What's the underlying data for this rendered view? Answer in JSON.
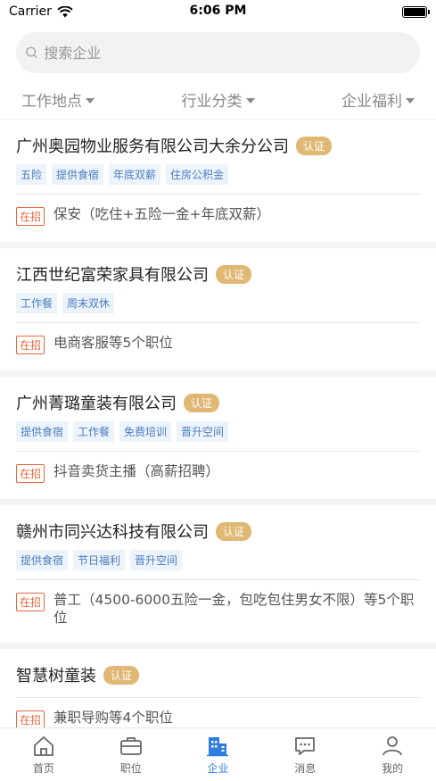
{
  "status": {
    "carrier": "Carrier",
    "time": "6:06 PM"
  },
  "search": {
    "placeholder": "搜索企业"
  },
  "filters": [
    {
      "label": "工作地点"
    },
    {
      "label": "行业分类"
    },
    {
      "label": "企业福利"
    }
  ],
  "companies": [
    {
      "name": "广州奥园物业服务有限公司大余分公司",
      "cert": "认证",
      "tags": [
        "五险",
        "提供食宿",
        "年底双薪",
        "住房公积金"
      ],
      "hiring": "在招",
      "job": "保安（吃住+五险一金+年底双薪）"
    },
    {
      "name": "江西世纪富荣家具有限公司",
      "cert": "认证",
      "tags": [
        "工作餐",
        "周末双休"
      ],
      "hiring": "在招",
      "job": "电商客服等5个职位"
    },
    {
      "name": "广州菁璐童装有限公司",
      "cert": "认证",
      "tags": [
        "提供食宿",
        "工作餐",
        "免费培训",
        "晋升空间"
      ],
      "hiring": "在招",
      "job": "抖音卖货主播（高薪招聘）"
    },
    {
      "name": "赣州市同兴达科技有限公司",
      "cert": "认证",
      "tags": [
        "提供食宿",
        "节日福利",
        "晋升空间"
      ],
      "hiring": "在招",
      "job": "普工（4500-6000五险一金，包吃包住男女不限）等5个职位"
    },
    {
      "name": "智慧树童装",
      "cert": "认证",
      "tags": [],
      "hiring": "在招",
      "job": "兼职导购等4个职位"
    }
  ],
  "tabbar": [
    {
      "label": "首页",
      "icon": "home-icon"
    },
    {
      "label": "职位",
      "icon": "briefcase-icon"
    },
    {
      "label": "企业",
      "icon": "building-icon",
      "active": true
    },
    {
      "label": "消息",
      "icon": "message-icon"
    },
    {
      "label": "我的",
      "icon": "user-icon"
    }
  ],
  "colors": {
    "accent": "#2f7de1",
    "cert": "#e0b874",
    "hiring": "#e8663c",
    "tag_text": "#4a7dbf",
    "tag_bg": "#edf3fb"
  }
}
